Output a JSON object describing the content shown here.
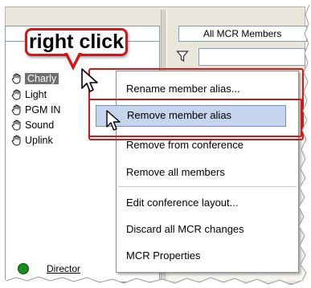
{
  "header": {
    "callout_text": "right click",
    "mcr_dropdown_value": "All MCR Members"
  },
  "members": [
    {
      "label": "Charly",
      "selected": true,
      "icon": "hand-icon"
    },
    {
      "label": "Light",
      "selected": false,
      "icon": "hand-icon"
    },
    {
      "label": "PGM IN",
      "selected": false,
      "icon": "hand-icon"
    },
    {
      "label": "Sound",
      "selected": false,
      "icon": "hand-icon"
    },
    {
      "label": "Uplink",
      "selected": false,
      "icon": "hand-icon"
    }
  ],
  "context_menu": {
    "items": [
      {
        "label": "Rename member alias..."
      },
      {
        "label": "Remove member alias",
        "highlighted": true
      },
      {
        "label": "Remove from conference"
      },
      {
        "label": "Remove all members"
      },
      {
        "label": "Edit conference layout..."
      },
      {
        "label": "Discard all MCR changes"
      },
      {
        "label": "MCR Properties"
      }
    ]
  },
  "right_list": {
    "director_label": "Director",
    "director_status_color": "#1f8a1f"
  },
  "colors": {
    "annotation_red": "#d01818",
    "menu_highlight": "#c6d5ee",
    "selection_gray": "#6f6f6f"
  }
}
